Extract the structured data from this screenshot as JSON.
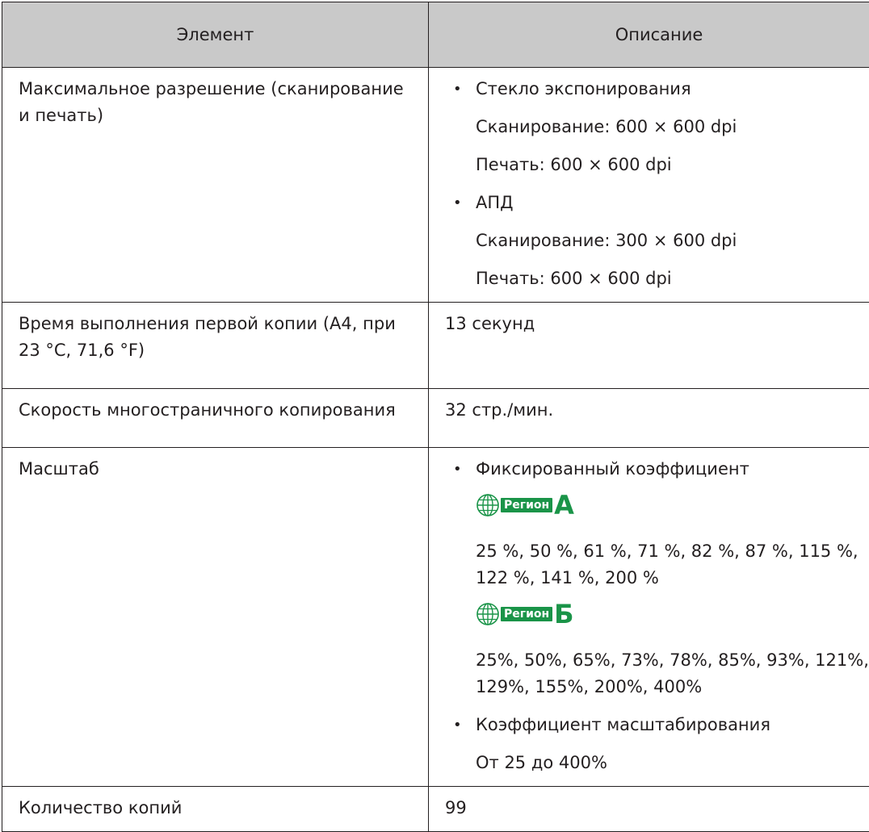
{
  "table": {
    "headers": {
      "element": "Элемент",
      "description": "Описание"
    },
    "resolution": {
      "element": "Максимальное разрешение (сканирование и печать)",
      "glass": {
        "title": "Стекло экспонирования",
        "scan": "Сканирование: 600 × 600 dpi",
        "print": "Печать: 600 × 600 dpi"
      },
      "adf": {
        "title": "АПД",
        "scan": "Сканирование: 300 × 600 dpi",
        "print": "Печать: 600 × 600 dpi"
      }
    },
    "first_copy": {
      "element": "Время выполнения первой копии (A4, при 23 °C, 71,6 °F)",
      "value": "13 секунд"
    },
    "multi_copy": {
      "element": "Скорость многостраничного копирования",
      "value": "32 стр./мин."
    },
    "scale": {
      "element": "Масштаб",
      "fixed_title": "Фиксированный коэффициент",
      "region_a": {
        "label": "Регион",
        "letter": "A",
        "values": "25 %, 50 %, 61 %, 71 %, 82 %, 87 %, 115 %, 122 %, 141 %, 200 %"
      },
      "region_b": {
        "label": "Регион",
        "letter": "Б",
        "values": "25%, 50%, 65%, 73%, 78%, 85%, 93%, 121%, 129%, 155%, 200%, 400%"
      },
      "zoom_title": "Коэффициент масштабирования",
      "zoom_value": "От 25 до 400%"
    },
    "copies": {
      "element": "Количество копий",
      "value": "99"
    }
  },
  "colors": {
    "header_bg": "#c9c9c9",
    "region_green": "#1a9448",
    "text": "#231f20"
  }
}
